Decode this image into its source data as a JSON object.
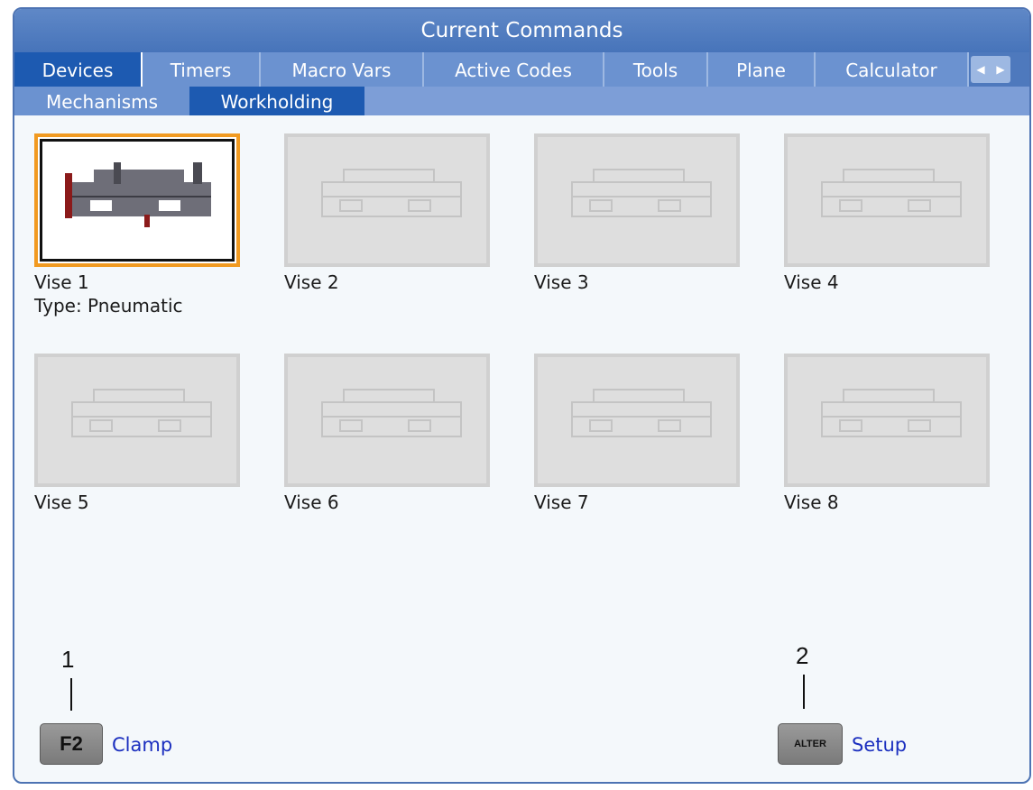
{
  "window": {
    "title": "Current Commands"
  },
  "tabs": [
    {
      "label": "Devices",
      "active": true
    },
    {
      "label": "Timers",
      "active": false
    },
    {
      "label": "Macro Vars",
      "active": false
    },
    {
      "label": "Active Codes",
      "active": false
    },
    {
      "label": "Tools",
      "active": false
    },
    {
      "label": "Plane",
      "active": false
    },
    {
      "label": "Calculator",
      "active": false
    }
  ],
  "subtabs": [
    {
      "label": "Mechanisms",
      "active": false
    },
    {
      "label": "Workholding",
      "active": true
    }
  ],
  "devices": [
    {
      "name": "Vise 1",
      "type": "Type: Pneumatic",
      "selected": true
    },
    {
      "name": "Vise 2",
      "selected": false
    },
    {
      "name": "Vise 3",
      "selected": false
    },
    {
      "name": "Vise 4",
      "selected": false
    },
    {
      "name": "Vise 5",
      "selected": false
    },
    {
      "name": "Vise 6",
      "selected": false
    },
    {
      "name": "Vise 7",
      "selected": false
    },
    {
      "name": "Vise 8",
      "selected": false
    }
  ],
  "callouts": {
    "one": "1",
    "two": "2"
  },
  "keys": {
    "f2": {
      "cap": "F2",
      "label": "Clamp"
    },
    "alter": {
      "cap": "ALTER",
      "label": "Setup"
    }
  },
  "colors": {
    "accent": "#f19a21",
    "tab_active": "#1d5ab1",
    "tab": "#6b92d0",
    "title": "#4d73b3",
    "key_label": "#1b2fbf"
  }
}
